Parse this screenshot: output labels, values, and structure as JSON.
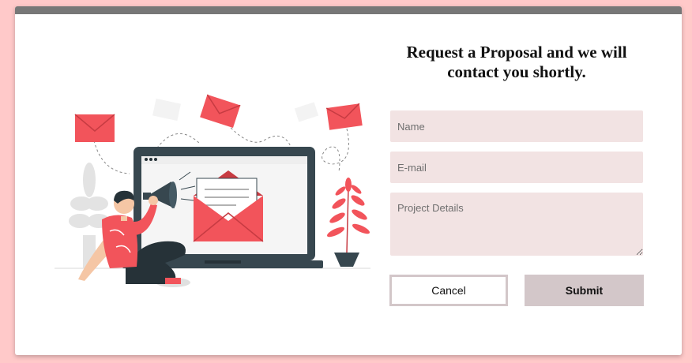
{
  "form": {
    "title_bold": "Request a Proposal",
    "title_rest": " and we will contact you shortly.",
    "name_placeholder": "Name",
    "email_placeholder": "E-mail",
    "details_placeholder": "Project Details",
    "cancel_label": "Cancel",
    "submit_label": "Submit"
  },
  "colors": {
    "page_background": "#ffc9c9",
    "accent_red": "#f2545b",
    "field_background": "#f2e3e3",
    "button_gray": "#d3c7c9",
    "laptop_dark": "#37474f"
  },
  "illustration": {
    "subject": "man-with-megaphone-laptop-envelopes"
  }
}
